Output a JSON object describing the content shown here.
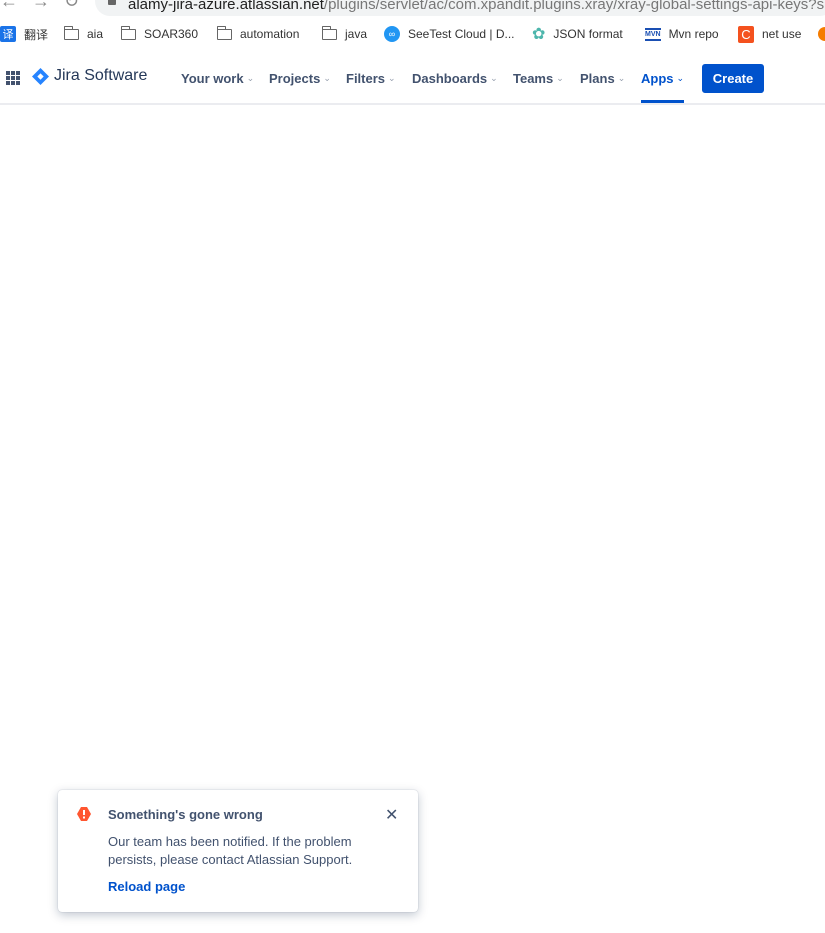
{
  "browser": {
    "url_host": "alamy-jira-azure.atlassian.net",
    "url_path": "/plugins/servlet/ac/com.xpandit.plugins.xray/xray-global-settings-api-keys?s",
    "bookmarks": [
      {
        "icon": "translate-icon",
        "label": "翻译"
      },
      {
        "icon": "folder-icon",
        "label": "aia"
      },
      {
        "icon": "folder-icon",
        "label": "SOAR360"
      },
      {
        "icon": "folder-icon",
        "label": "automation"
      },
      {
        "icon": "folder-icon",
        "label": "java"
      },
      {
        "icon": "seetest-icon",
        "label": "SeeTest Cloud | D..."
      },
      {
        "icon": "json-format-icon",
        "label": "JSON format"
      },
      {
        "icon": "mvn-icon",
        "label": "Mvn repo"
      },
      {
        "icon": "c-icon",
        "label": "net use"
      }
    ],
    "translate_glyph": "译",
    "mvn_glyph": "MVN",
    "c_glyph": "C"
  },
  "nav": {
    "product": "Jira Software",
    "items": [
      {
        "label": "Your work"
      },
      {
        "label": "Projects"
      },
      {
        "label": "Filters"
      },
      {
        "label": "Dashboards"
      },
      {
        "label": "Teams"
      },
      {
        "label": "Plans"
      },
      {
        "label": "Apps",
        "active": true
      }
    ],
    "create_label": "Create",
    "accent": "#0052cc"
  },
  "toast": {
    "title": "Something's gone wrong",
    "body": "Our team has been notified. If the problem persists, please contact Atlassian Support.",
    "action": "Reload page",
    "icon": "error-icon",
    "icon_color": "#ff5630"
  }
}
